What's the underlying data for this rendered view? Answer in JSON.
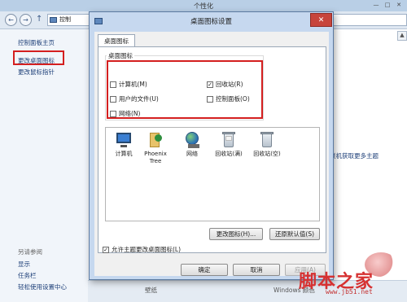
{
  "background_window": {
    "title": "个性化",
    "caption_buttons": [
      "—",
      "□",
      "✕"
    ],
    "address_text": "控制",
    "nav_right_text": "",
    "sidebar": {
      "home_link": "控制面板主页",
      "change_icons_link": "更改桌面图标",
      "change_pointer_link": "更改鼠标指针",
      "see_also_label": "另请参阅",
      "bottom_links": [
        "显示",
        "任务栏",
        "轻松使用设置中心"
      ]
    },
    "right_link": "联机获取更多主题",
    "bottom_items": [
      "壁纸",
      "Windows 颜色"
    ],
    "scroll_up_glyph": "▲"
  },
  "dialog": {
    "title": "桌面图标设置",
    "close_glyph": "✕",
    "tab_label": "桌面图标",
    "group_label": "桌面图标",
    "checkboxes": [
      {
        "label": "计算机(M)",
        "checked": false
      },
      {
        "label": "用户的文件(U)",
        "checked": false
      },
      {
        "label": "网络(N)",
        "checked": false
      },
      {
        "label": "回收站(R)",
        "checked": true
      },
      {
        "label": "控制面板(O)",
        "checked": false
      }
    ],
    "icons": [
      {
        "name": "computer",
        "label": "计算机"
      },
      {
        "name": "user-files",
        "label": "Phoenix Tree"
      },
      {
        "name": "network",
        "label": "网络"
      },
      {
        "name": "recycle-bin-full",
        "label": "回收站(满)"
      },
      {
        "name": "recycle-bin-empty",
        "label": "回收站(空)"
      }
    ],
    "change_icon_button": "更改图标(H)...",
    "restore_default_button": "还原默认值(S)",
    "allow_themes_checkbox": {
      "label": "允许主题更改桌面图标(L)",
      "checked": true
    },
    "ok_button": "确定",
    "cancel_button": "取消",
    "apply_button": "应用(A)"
  },
  "watermark": {
    "text": "脚本之家",
    "url": "www.jb51.net"
  },
  "colors": {
    "highlight_red": "#d41f1f",
    "link_blue": "#1d3f78",
    "close_red": "#c7453c"
  }
}
